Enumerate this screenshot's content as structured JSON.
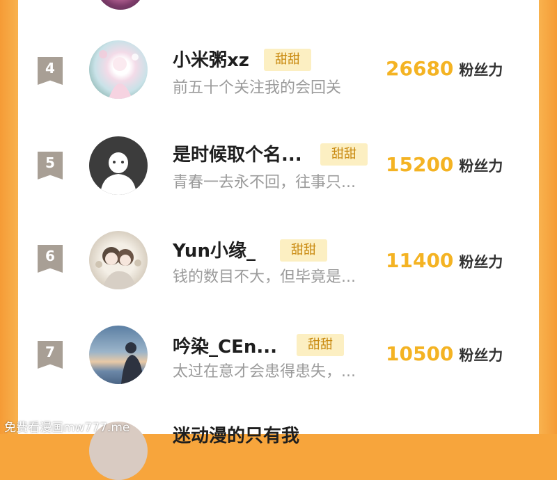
{
  "rows": [
    {
      "rank": "4",
      "name": "小米粥xz",
      "tag": "甜甜",
      "signature": "前五十个关注我的会回关",
      "fans": "26680",
      "fans_label": "粉丝力",
      "avatar": "avatar-girl-pink-icon"
    },
    {
      "rank": "5",
      "name": "是时候取个名...",
      "tag": "甜甜",
      "signature": "青春一去永不回，往事只...",
      "fans": "15200",
      "fans_label": "粉丝力",
      "avatar": "avatar-default-silhouette-icon"
    },
    {
      "rank": "6",
      "name": "Yun小缘_",
      "tag": "甜甜",
      "signature": "钱的数目不大，但毕竟是...",
      "fans": "11400",
      "fans_label": "粉丝力",
      "avatar": "avatar-anime-pair-icon"
    },
    {
      "rank": "7",
      "name": "吟染_CEn...",
      "tag": "甜甜",
      "signature": "太过在意才会患得患失，...",
      "fans": "10500",
      "fans_label": "粉丝力",
      "avatar": "avatar-sunset-silhouette-icon"
    }
  ],
  "next_name": "迷动漫的只有我",
  "watermark": "免费看漫画mw777.me",
  "colors": {
    "background": "#F7A53C",
    "tag_bg": "#FCEFC2",
    "tag_text": "#C98A10",
    "fans_number": "#F4B323",
    "rank_badge": "#A89F95"
  }
}
